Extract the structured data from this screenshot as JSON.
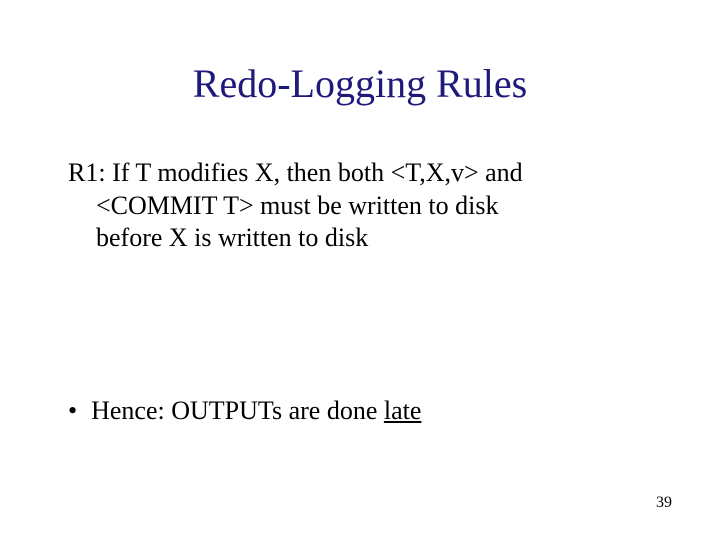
{
  "title": "Redo-Logging Rules",
  "rule": {
    "line1": "R1: If T modifies X, then both <T,X,v> and",
    "line2": "<COMMIT T> must be written to disk",
    "line3": "before X is written to disk"
  },
  "bullet": {
    "dot": "•",
    "prefix": "Hence: OUTPUTs are done ",
    "emph": "late"
  },
  "page_number": "39"
}
